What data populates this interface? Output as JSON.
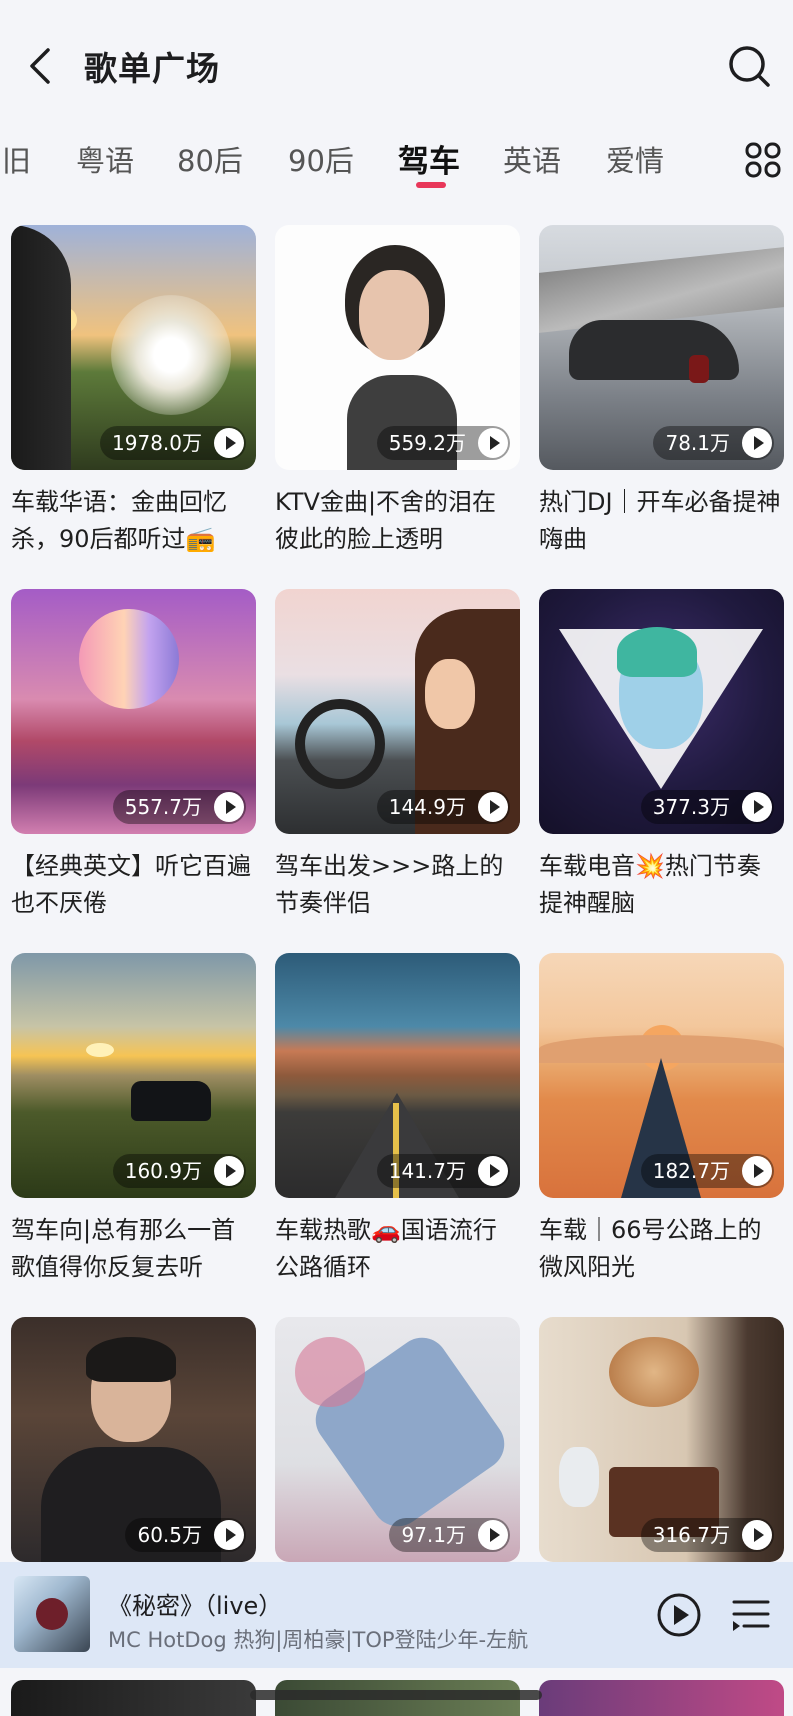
{
  "header": {
    "title": "歌单广场",
    "back_icon": "back-chevron-icon",
    "search_icon": "search-icon"
  },
  "tabs": [
    {
      "label": "旧",
      "active": false
    },
    {
      "label": "粤语",
      "active": false
    },
    {
      "label": "80后",
      "active": false
    },
    {
      "label": "90后",
      "active": false
    },
    {
      "label": "驾车",
      "active": true
    },
    {
      "label": "英语",
      "active": false
    },
    {
      "label": "爱情",
      "active": false
    }
  ],
  "tab_accent": "#e8375a",
  "more_tabs_icon": "grid-menu-icon",
  "playlists": [
    {
      "title": "车载华语：金曲回忆杀，90后都听过📻",
      "count": "1978.0万"
    },
    {
      "title": "KTV金曲|不舍的泪在彼此的脸上透明",
      "count": "559.2万"
    },
    {
      "title": "热门DJ｜开车必备提神嗨曲",
      "count": "78.1万"
    },
    {
      "title": "【经典英文】听它百遍也不厌倦",
      "count": "557.7万"
    },
    {
      "title": "驾车出发>>>路上的节奏伴侣",
      "count": "144.9万"
    },
    {
      "title": "车载电音💥热门节奏 提神醒脑",
      "count": "377.3万"
    },
    {
      "title": "驾车向|总有那么一首歌值得你反复去听",
      "count": "160.9万"
    },
    {
      "title": "车载热歌🚗国语流行公路循环",
      "count": "141.7万"
    },
    {
      "title": "车载｜66号公路上的微风阳光",
      "count": "182.7万"
    },
    {
      "title": "",
      "count": "60.5万"
    },
    {
      "title": "",
      "count": "97.1万"
    },
    {
      "title": "",
      "count": "316.7万"
    }
  ],
  "player": {
    "song": "《秘密》（live）",
    "artist": "MC HotDog 热狗|周柏豪|TOP登陆少年-左航",
    "play_icon": "play-circle-icon",
    "playlist_icon": "playlist-icon"
  }
}
